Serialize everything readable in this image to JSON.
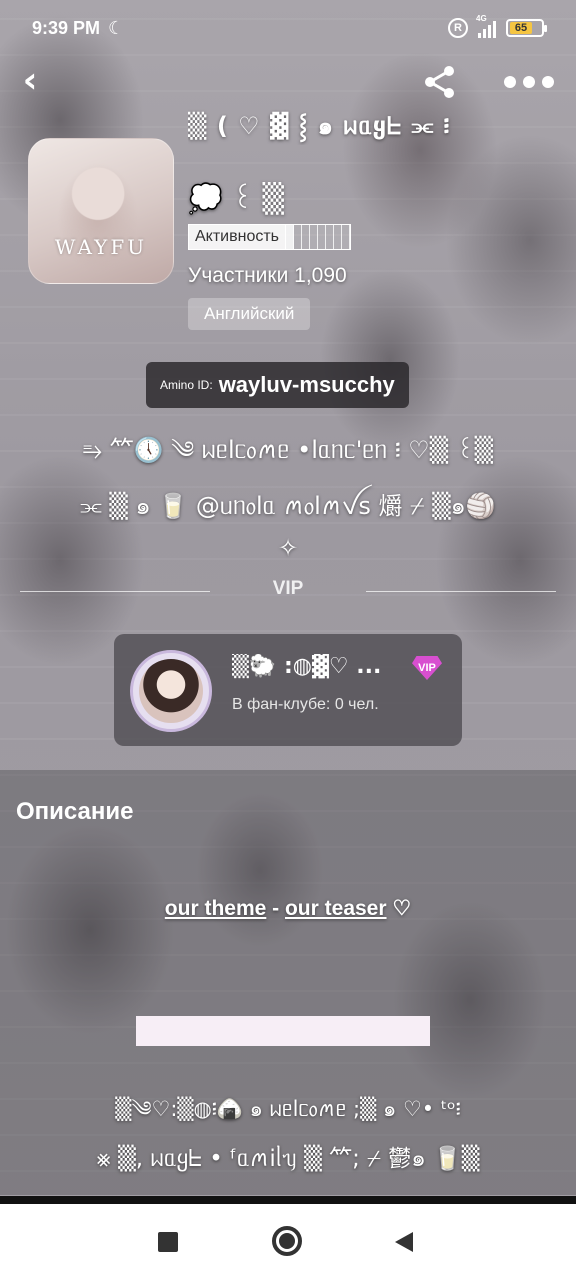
{
  "status_bar": {
    "time": "9:39 PM",
    "moon_icon": "☾",
    "r_icon": "R",
    "signal_label": "4G",
    "battery": "65"
  },
  "header": {
    "back_icon": "‹",
    "share_icon": "share-icon",
    "more_icon": "more-icon"
  },
  "community": {
    "title": "▒ ( ♡ ▓ ⸾ ๑ ᥕᥲყᖶ ⫘ ፧",
    "subtitle": "💭 ꒰ ▒",
    "icon_text": "WAYFU",
    "activity_label": "Активность",
    "members_label": "Участники",
    "members_count": "1,090",
    "language": "Английский",
    "amino_id_label": "Amino ID:",
    "amino_id": "wayluv-msucchy"
  },
  "decorations": {
    "line1": "⥱ 𥫗🕔 ༄ ᥕᥱlᥴ᥆ꪔᥱ •lᥲᥒᥴ'ᥱᥒ ፧ ♡▒ ꒰▒",
    "line2": "⫘ ▒ ๑ 🥛 @ᥙᥒ᥆lᥲ ꪔ᥆lꪔꪜs 爝 ⌿ ▒๑🏐",
    "line3": "✧",
    "line4": "▒༄♡:▒◍፧🍙 ๑ ᥕᥱlᥴ᥆ꪔᥱ ;▒ ๑ ♡• ᵗᵒ፧",
    "line5": "⨳ ▒, ᥕᥲყᖶ • ᶠᥲꪔiᥣᥡ ▒ 𥫗; ⌿ 鬱๑ 🥛▒"
  },
  "vip": {
    "divider_label": "VIP",
    "name": "▒🐑 :◍▓♡ ...",
    "badge": "VIP",
    "members_text": "В фан-клубе: 0 чел."
  },
  "description": {
    "heading": "Описание",
    "link1": "our theme",
    "separator": " - ",
    "link2": "our teaser",
    "heart": " ♡"
  },
  "nav": {
    "recents": "recents-button",
    "home": "home-button",
    "back": "back-button"
  },
  "colors": {
    "vip_badge": "#d84fd0",
    "battery": "#f5c542",
    "nav_bg": "#ffffff"
  }
}
